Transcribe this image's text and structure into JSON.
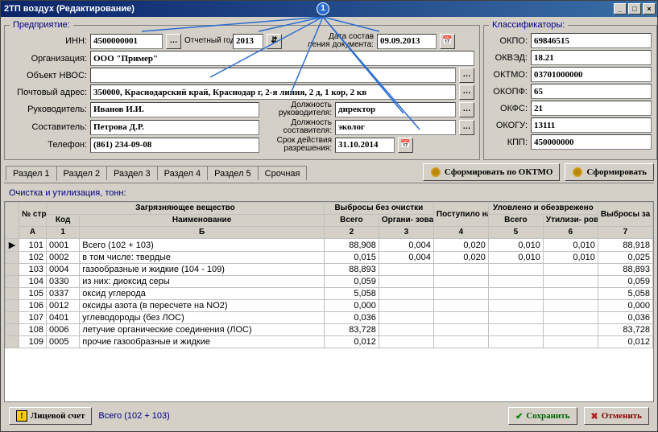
{
  "window": {
    "title": "2ТП воздух (Редактирование)"
  },
  "callout": {
    "num": "1"
  },
  "enterprise": {
    "legend": "Предприятие:",
    "inn_label": "ИНН:",
    "inn": "4500000001",
    "year_label": "Отчетный год:",
    "year": "2013",
    "doc_date_label1": "Дата состав",
    "doc_date_label2": "ления документа:",
    "doc_date": "09.09.2013",
    "org_label": "Организация:",
    "org": "ООО \"Пример\"",
    "nvos_label": "Объект НВОС:",
    "nvos": "",
    "addr_label": "Почтовый адрес:",
    "addr": "350000, Краснодарский край, Краснодар г, 2-я линия, 2 д, 1 кор, 2 кв",
    "head_label": "Руководитель:",
    "head": "Иванов И.И.",
    "head_pos_label1": "Должность",
    "head_pos_label2": "руководителя:",
    "head_pos": "директор",
    "comp_label": "Составитель:",
    "comp": "Петрова Д.Р.",
    "comp_pos_label1": "Должность",
    "comp_pos_label2": "составителя:",
    "comp_pos": "эколог",
    "phone_label": "Телефон:",
    "phone": "(861) 234-09-08",
    "permit_label1": "Срок действия",
    "permit_label2": "разрешения:",
    "permit": "31.10.2014"
  },
  "classifiers": {
    "legend": "Классификаторы:",
    "okpo_label": "ОКПО:",
    "okpo": "69846515",
    "okved_label": "ОКВЭД:",
    "okved": "18.21",
    "oktmo_label": "ОКТМО:",
    "oktmo": "03701000000",
    "okopf_label": "ОКОПФ:",
    "okopf": "65",
    "okfs_label": "ОКФС:",
    "okfs": "21",
    "okogu_label": "ОКОГУ:",
    "okogu": "13111",
    "kpp_label": "КПП:",
    "kpp": "450000000"
  },
  "tabs": {
    "items": [
      "Раздел 1",
      "Раздел 2",
      "Раздел 3",
      "Раздел 4",
      "Раздел 5",
      "Срочная"
    ],
    "form_oktmo": "Сформировать по ОКТМО",
    "form": "Сформировать"
  },
  "section_title": "Очистка и утилизация, тонн:",
  "grid": {
    "head": {
      "nstr": "№ стр.",
      "pollutant": "Загрязняющее вещество",
      "kod": "Код",
      "name": "Наименование",
      "no_clean": "Выбросы без очистки",
      "vsego": "Всего",
      "organiz": "Органи- зованные",
      "to_clean": "Поступило на очистку всего:",
      "captured": "Уловлено и обезврежено",
      "util": "Утилизи- ровано",
      "year": "Выбросы за отчетный год",
      "a": "А",
      "one": "1",
      "b": "Б",
      "two": "2",
      "three": "3",
      "four": "4",
      "five": "5",
      "six": "6",
      "seven": "7"
    },
    "rows": [
      {
        "ind": "▶",
        "n": "101",
        "kod": "0001",
        "name": "Всего (102 + 103)",
        "c2": "88,908",
        "c3": "0,004",
        "c4": "0,020",
        "c5": "0,010",
        "c6": "0,010",
        "c7": "88,918"
      },
      {
        "ind": "",
        "n": "102",
        "kod": "0002",
        "name": "в том числе: твердые",
        "c2": "0,015",
        "c3": "0,004",
        "c4": "0,020",
        "c5": "0,010",
        "c6": "0,010",
        "c7": "0,025"
      },
      {
        "ind": "",
        "n": "103",
        "kod": "0004",
        "name": "газообразные и жидкие (104 - 109)",
        "c2": "88,893",
        "c3": "",
        "c4": "",
        "c5": "",
        "c6": "",
        "c7": "88,893"
      },
      {
        "ind": "",
        "n": "104",
        "kod": "0330",
        "name": "из них: диоксид серы",
        "c2": "0,059",
        "c3": "",
        "c4": "",
        "c5": "",
        "c6": "",
        "c7": "0,059"
      },
      {
        "ind": "",
        "n": "105",
        "kod": "0337",
        "name": "оксид углерода",
        "c2": "5,058",
        "c3": "",
        "c4": "",
        "c5": "",
        "c6": "",
        "c7": "5,058"
      },
      {
        "ind": "",
        "n": "106",
        "kod": "0012",
        "name": "оксиды азота (в пересчете на NO2)",
        "c2": "0,000",
        "c3": "",
        "c4": "",
        "c5": "",
        "c6": "",
        "c7": "0,000"
      },
      {
        "ind": "",
        "n": "107",
        "kod": "0401",
        "name": "углеводороды (без ЛОС)",
        "c2": "0,036",
        "c3": "",
        "c4": "",
        "c5": "",
        "c6": "",
        "c7": "0,036"
      },
      {
        "ind": "",
        "n": "108",
        "kod": "0006",
        "name": "летучие органические соединения (ЛОС)",
        "c2": "83,728",
        "c3": "",
        "c4": "",
        "c5": "",
        "c6": "",
        "c7": "83,728"
      },
      {
        "ind": "",
        "n": "109",
        "kod": "0005",
        "name": "прочие газообразные и жидкие",
        "c2": "0,012",
        "c3": "",
        "c4": "",
        "c5": "",
        "c6": "",
        "c7": "0,012"
      }
    ]
  },
  "bottom": {
    "account": "Лицевой счет",
    "status": "Всего (102 + 103)",
    "save": "Сохранить",
    "cancel": "Отменить"
  }
}
